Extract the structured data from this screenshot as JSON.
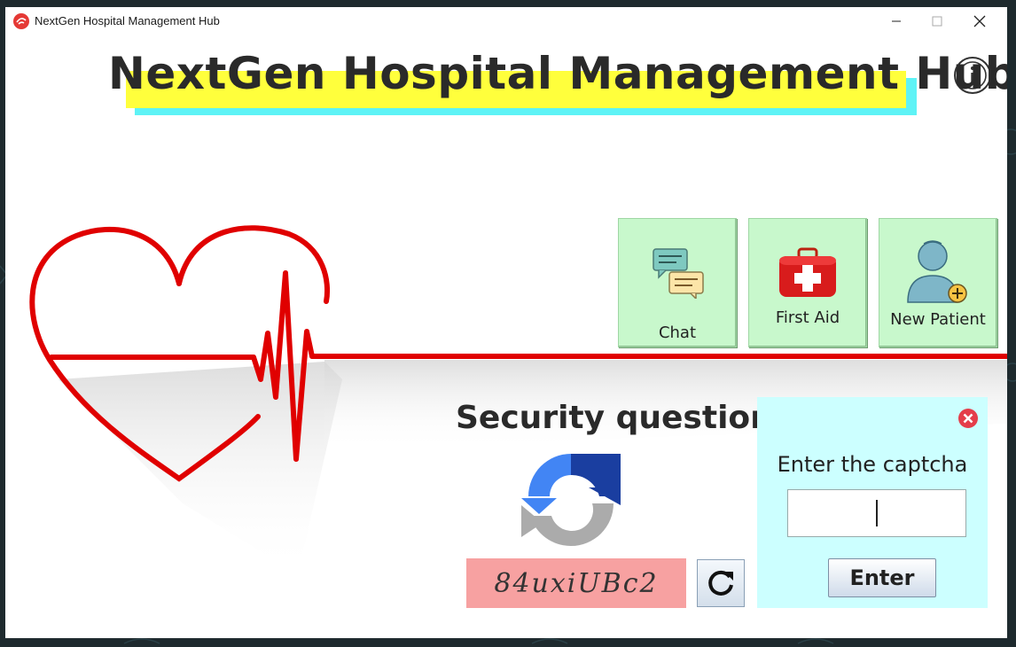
{
  "window": {
    "title": "NextGen Hospital Management Hub",
    "app_icon": "app-logo-icon"
  },
  "header": {
    "title": "NextGen Hospital Management Hub",
    "info_icon": "info-icon",
    "highlight_colors": [
      "#ffff3c",
      "#5ef3f6"
    ]
  },
  "actions": [
    {
      "label": "Chat",
      "icon": "chat-icon"
    },
    {
      "label": "First Aid",
      "icon": "first-aid-kit-icon"
    },
    {
      "label": "New Patient",
      "icon": "new-patient-icon"
    }
  ],
  "security": {
    "title": "Security question",
    "logo_icon": "recaptcha-icon",
    "captcha_code": "84uxiUBc2",
    "refresh_icon": "refresh-icon"
  },
  "captcha_panel": {
    "label": "Enter the captcha",
    "input_value": "",
    "submit_label": "Enter",
    "close_icon": "close-circle-icon"
  },
  "colors": {
    "accent_red": "#e00000",
    "tile_green": "#c8f8cc",
    "panel_cyan": "#ccffff",
    "captcha_pink": "#f7a1a1"
  }
}
